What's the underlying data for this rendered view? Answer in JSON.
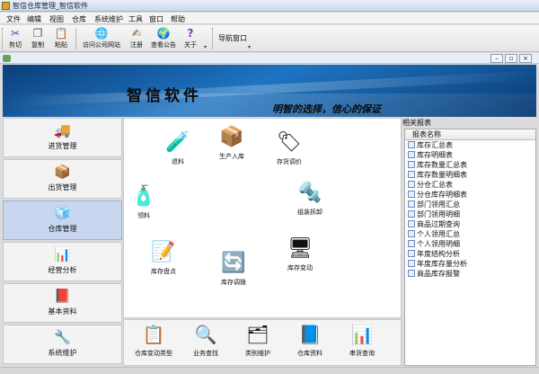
{
  "window": {
    "title": "智信仓库管理_智信软件"
  },
  "menu": [
    "文件",
    "编辑",
    "视图",
    "仓库",
    "系统维护",
    "工具",
    "窗口",
    "帮助"
  ],
  "toolbar": {
    "buttons": [
      {
        "label": "剪切",
        "icon": "scissors-icon",
        "glyph": "✂"
      },
      {
        "label": "复制",
        "icon": "copy-icon",
        "glyph": "❐"
      },
      {
        "label": "粘贴",
        "icon": "paste-icon",
        "glyph": "📋"
      },
      {
        "label": "访问公司网站",
        "icon": "globe-icon",
        "glyph": "🌐"
      },
      {
        "label": "注册",
        "icon": "register-icon",
        "glyph": "✍"
      },
      {
        "label": "查看公告",
        "icon": "notice-icon",
        "glyph": "🌍"
      },
      {
        "label": "关于",
        "icon": "help-icon",
        "glyph": "?"
      }
    ],
    "nav_window": "导航窗口"
  },
  "banner": {
    "title": "智信软件",
    "slogan": "明智的选择，信心的保证"
  },
  "left_tabs": [
    {
      "label": "进货管理",
      "icon": "truck-icon",
      "glyph": "🚚"
    },
    {
      "label": "出货管理",
      "icon": "shipment-icon",
      "glyph": "📦"
    },
    {
      "label": "仓库管理",
      "icon": "warehouse-icon",
      "glyph": "🧊"
    },
    {
      "label": "经营分析",
      "icon": "analysis-icon",
      "glyph": "📊"
    },
    {
      "label": "基本资料",
      "icon": "basic-data-icon",
      "glyph": "📕"
    },
    {
      "label": "系统维护",
      "icon": "maintenance-icon",
      "glyph": "🔧"
    }
  ],
  "selected_tab": "仓库管理",
  "functions": [
    {
      "label": "退料",
      "icon": "return-material-icon",
      "glyph": "🧪"
    },
    {
      "label": "生产入库",
      "icon": "production-in-icon",
      "glyph": "📦"
    },
    {
      "label": "存货调价",
      "icon": "price-tag-icon",
      "glyph": "🏷"
    },
    {
      "label": "领料",
      "icon": "pick-material-icon",
      "glyph": "🧴"
    },
    {
      "label": "组装拆卸",
      "icon": "drill-icon",
      "glyph": "🔩"
    },
    {
      "label": "库存盘点",
      "icon": "inventory-check-icon",
      "glyph": "📝"
    },
    {
      "label": "库存调拨",
      "icon": "transfer-icon",
      "glyph": "🔄"
    },
    {
      "label": "库存变动",
      "icon": "stock-change-icon",
      "glyph": "🖥"
    }
  ],
  "bottom_buttons": [
    {
      "label": "仓库变动类型",
      "icon": "change-type-icon",
      "glyph": "📋"
    },
    {
      "label": "业务查找",
      "icon": "search-icon",
      "glyph": "🔍"
    },
    {
      "label": "类别维护",
      "icon": "category-icon",
      "glyph": "🗂"
    },
    {
      "label": "仓库资料",
      "icon": "warehouse-data-icon",
      "glyph": "📘"
    },
    {
      "label": "串货查询",
      "icon": "query-chart-icon",
      "glyph": "📊"
    }
  ],
  "reports": {
    "title": "相关报表",
    "column": "报表名称",
    "items": [
      "库存汇总表",
      "库存明细表",
      "库存数量汇总表",
      "库存数量明细表",
      "分仓汇总表",
      "分仓库存明细表",
      "部门领用汇总",
      "部门领用明细",
      "商品过期查询",
      "个人领用汇总",
      "个人领用明细",
      "年度结构分析",
      "年度库存量分析",
      "商品库存报警"
    ]
  }
}
